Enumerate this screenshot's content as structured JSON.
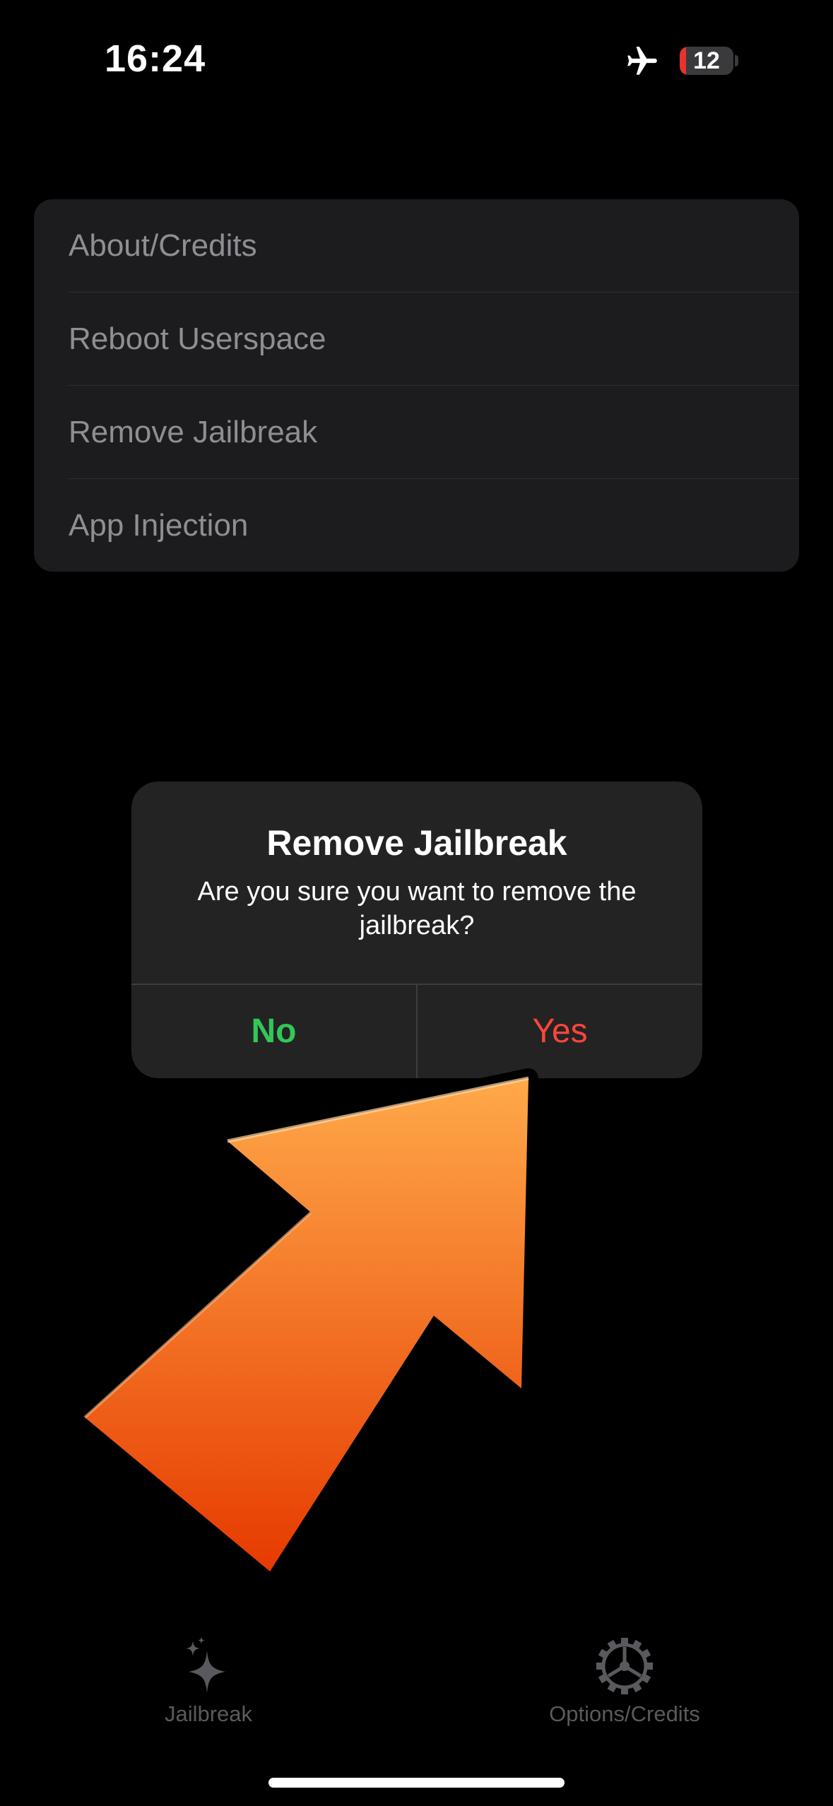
{
  "status_bar": {
    "time": "16:24",
    "battery_level": "12",
    "battery_fraction": 0.12,
    "airplane_mode": true
  },
  "menu": {
    "items": [
      {
        "label": "About/Credits"
      },
      {
        "label": "Reboot Userspace"
      },
      {
        "label": "Remove Jailbreak"
      },
      {
        "label": "App Injection"
      }
    ]
  },
  "alert": {
    "title": "Remove Jailbreak",
    "message": "Are you sure you want to remove the jailbreak?",
    "no_label": "No",
    "yes_label": "Yes"
  },
  "tab_bar": {
    "tabs": [
      {
        "label": "Jailbreak",
        "icon": "sparkles-icon"
      },
      {
        "label": "Options/Credits",
        "icon": "gear-icon"
      }
    ]
  },
  "colors": {
    "no_button": "#32c759",
    "yes_button": "#ff453a",
    "arrow_top": "#ffa94a",
    "arrow_bottom": "#e63a00"
  }
}
